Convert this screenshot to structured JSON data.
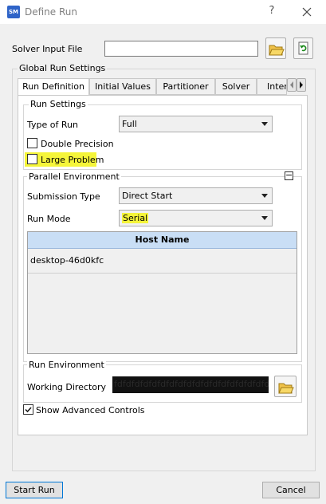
{
  "window": {
    "title": "Define Run",
    "app_badge": "SM",
    "help_label": "?"
  },
  "solver_input": {
    "label": "Solver Input File",
    "value": ""
  },
  "global_settings": {
    "caption": "Global Run Settings"
  },
  "tabs": [
    {
      "label": "Run Definition",
      "active": true
    },
    {
      "label": "Initial Values",
      "active": false
    },
    {
      "label": "Partitioner",
      "active": false
    },
    {
      "label": "Solver",
      "active": false
    },
    {
      "label": "Interp",
      "active": false
    }
  ],
  "run_settings": {
    "caption": "Run Settings",
    "type_of_run_label": "Type of Run",
    "type_of_run_value": "Full",
    "double_precision_label": "Double Precision",
    "double_precision_checked": false,
    "large_problem_label": "Large Problem",
    "large_problem_checked": false
  },
  "parallel_env": {
    "caption": "Parallel Environment",
    "collapse_symbol": "−",
    "submission_type_label": "Submission Type",
    "submission_type_value": "Direct Start",
    "run_mode_label": "Run Mode",
    "run_mode_value": "Serial",
    "host_table": {
      "header": "Host Name",
      "rows": [
        "desktop-46d0kfc"
      ]
    }
  },
  "run_env": {
    "caption": "Run Environment",
    "working_dir_label": "Working Directory",
    "working_dir_value": "fdfdfdfdfdfdfdfdfdfdfdfdfdfdfdfdfdfdfd"
  },
  "advanced": {
    "label": "Show Advanced Controls",
    "checked": true
  },
  "buttons": {
    "start_run": "Start Run",
    "cancel": "Cancel"
  },
  "colors": {
    "highlight": "#f5f53a",
    "table_header": "#c9def5",
    "accent": "#0078d7"
  }
}
